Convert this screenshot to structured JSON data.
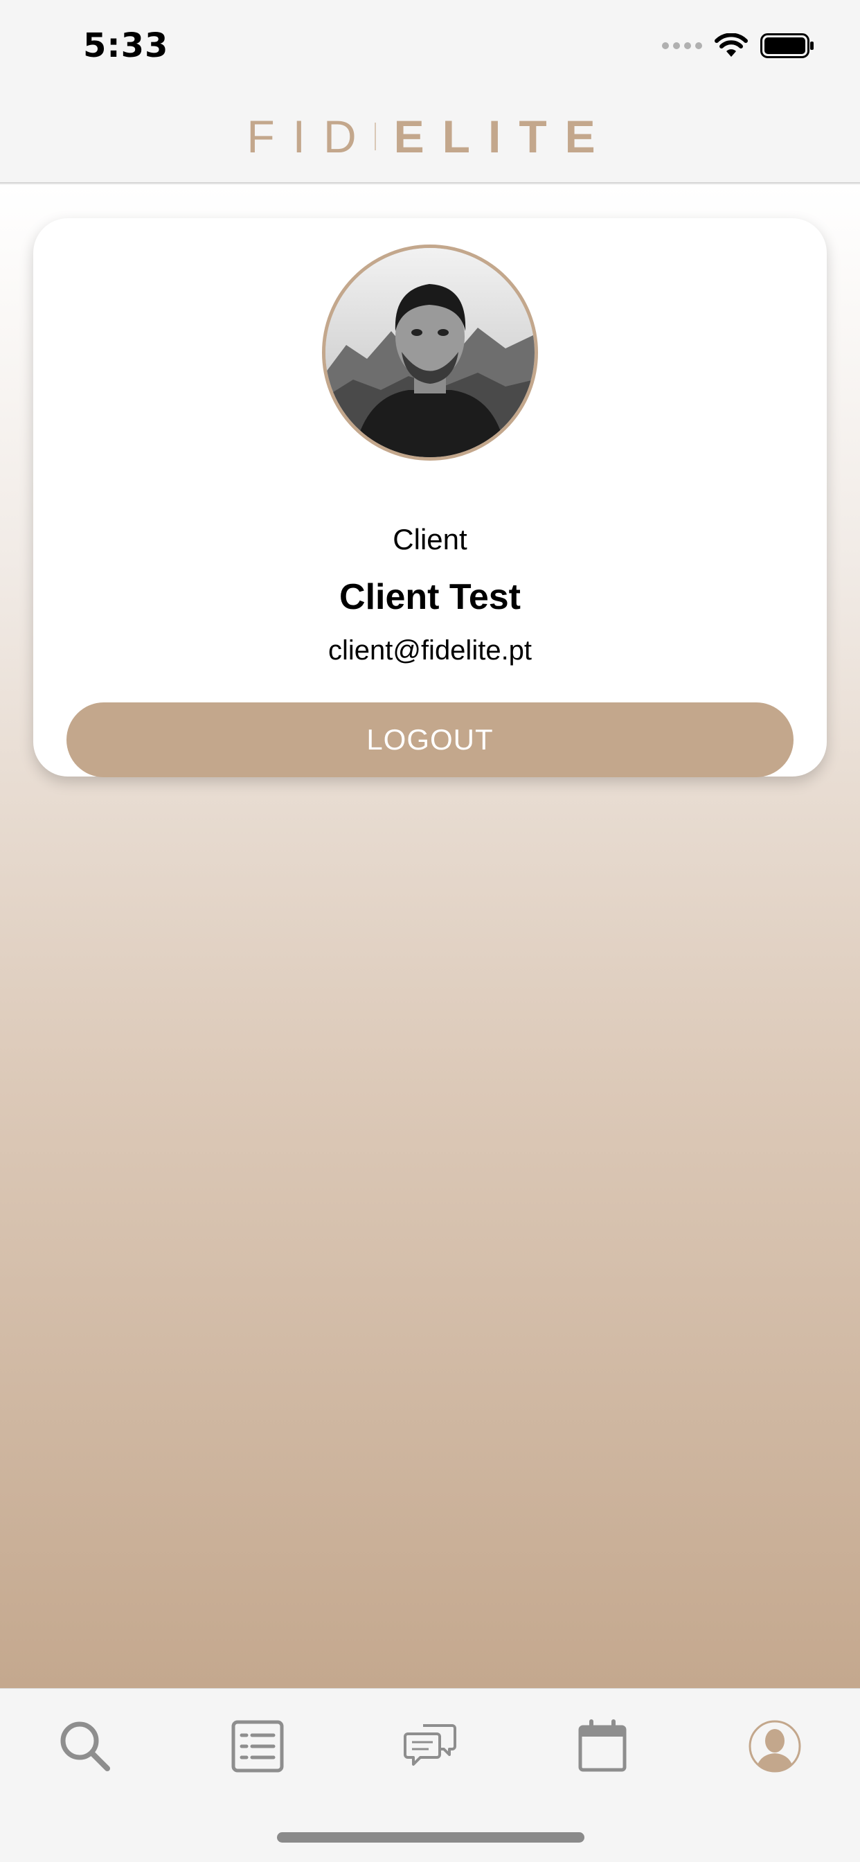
{
  "status_bar": {
    "time": "5:33"
  },
  "header": {
    "logo_left": "FID",
    "logo_right": "ELITE"
  },
  "profile": {
    "role": "Client",
    "name": "Client Test",
    "email": "client@fidelite.pt",
    "logout_label": "LOGOUT"
  },
  "tab_bar": {
    "tabs": [
      {
        "icon": "search-icon",
        "active": false
      },
      {
        "icon": "list-icon",
        "active": false
      },
      {
        "icon": "chat-icon",
        "active": false
      },
      {
        "icon": "calendar-icon",
        "active": false
      },
      {
        "icon": "profile-icon",
        "active": true
      }
    ]
  },
  "colors": {
    "accent": "#c3a78c",
    "tab_inactive": "#8e8e8e",
    "background": "#f5f5f5"
  }
}
